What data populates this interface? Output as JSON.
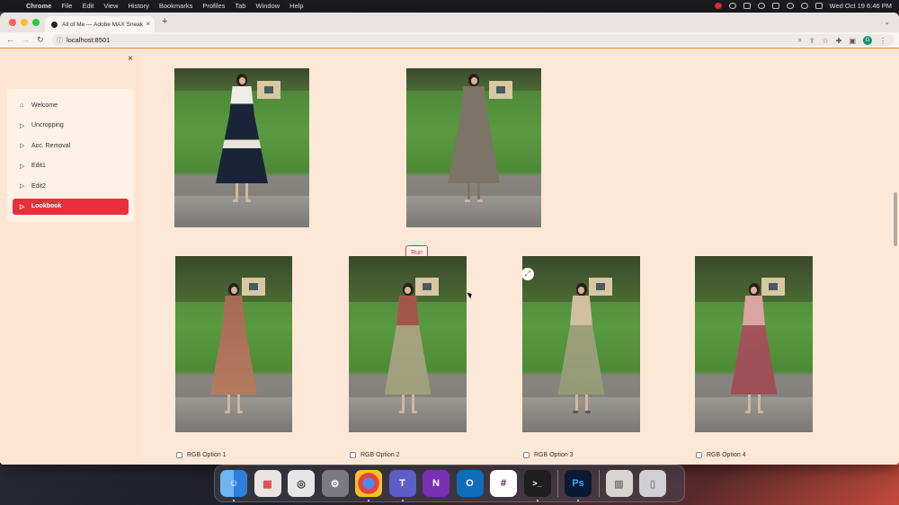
{
  "menubar": {
    "apple_icon": "apple-icon",
    "app_name": "Chrome",
    "menus": [
      "File",
      "Edit",
      "View",
      "History",
      "Bookmarks",
      "Profiles",
      "Tab",
      "Window",
      "Help"
    ],
    "datetime": "Wed Oct 19  6:46 PM"
  },
  "browser": {
    "tab_title": "All of Me — Adobe MAX Sneak",
    "tab_close": "×",
    "new_tab": "+",
    "url": "localhost:8501",
    "profile_initial": "G"
  },
  "sidebar": {
    "close": "×",
    "items": [
      {
        "label": "Welcome",
        "icon": "home-icon",
        "glyph": "⌂"
      },
      {
        "label": "Uncropping",
        "icon": "play-icon",
        "glyph": "▷"
      },
      {
        "label": "Acc. Removal",
        "icon": "play-icon",
        "glyph": "▷"
      },
      {
        "label": "Edit1",
        "icon": "play-icon",
        "glyph": "▷"
      },
      {
        "label": "Edit2",
        "icon": "play-icon",
        "glyph": "▷"
      },
      {
        "label": "Lookbook",
        "icon": "play-icon",
        "glyph": "▷",
        "active": true
      }
    ]
  },
  "main": {
    "run_label": "Run",
    "options": [
      "RGB Option 1",
      "RGB Option 2",
      "RGB Option 3",
      "RGB Option 4"
    ]
  },
  "colors": {
    "accent": "#ea2f3c",
    "page_bg": "#fde8d8"
  },
  "dock": {
    "apps": [
      {
        "name": "finder-icon",
        "glyph": "☺"
      },
      {
        "name": "launchpad-icon",
        "glyph": "▦"
      },
      {
        "name": "screenshot-icon",
        "glyph": "◎"
      },
      {
        "name": "system-settings-icon",
        "glyph": "⚙"
      },
      {
        "name": "chrome-icon",
        "glyph": "●"
      },
      {
        "name": "teams-icon",
        "glyph": "T"
      },
      {
        "name": "onenote-icon",
        "glyph": "N"
      },
      {
        "name": "outlook-icon",
        "glyph": "O"
      },
      {
        "name": "slack-icon",
        "glyph": "#"
      },
      {
        "name": "terminal-icon",
        "glyph": ">_"
      },
      {
        "name": "photoshop-icon",
        "glyph": "Ps"
      },
      {
        "name": "archive-icon",
        "glyph": "▥"
      },
      {
        "name": "trash-icon",
        "glyph": "▯"
      }
    ]
  }
}
